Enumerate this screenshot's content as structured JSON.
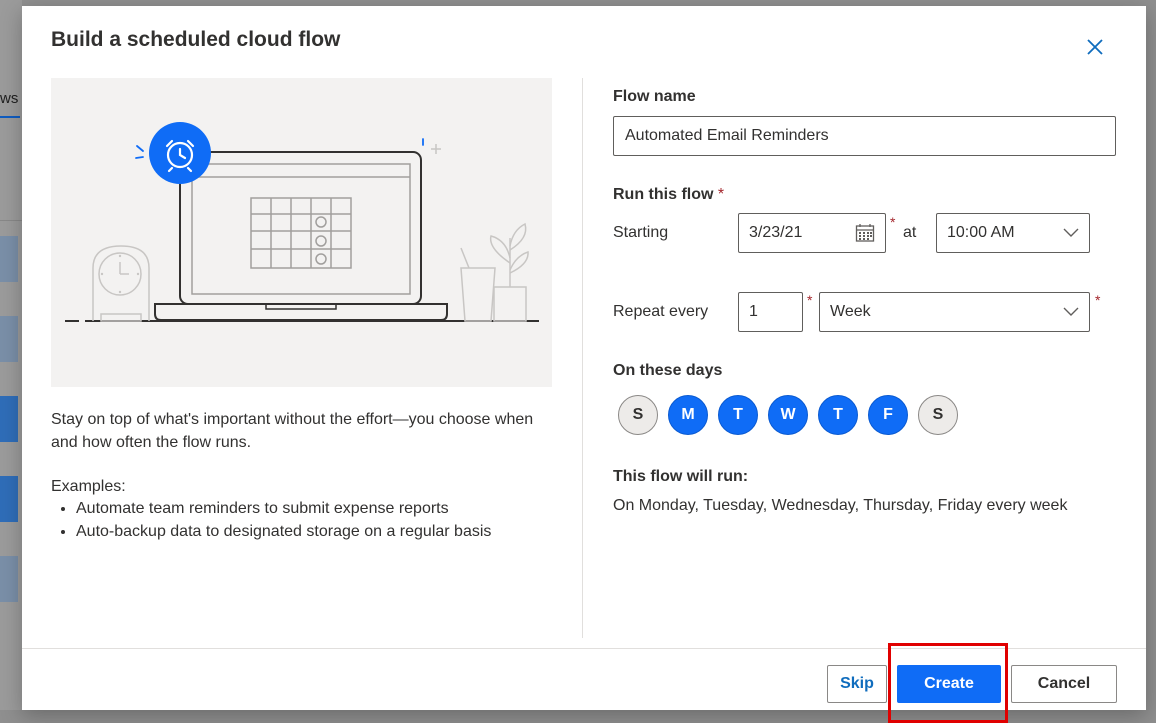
{
  "background": {
    "tab_fragment": "ws"
  },
  "dialog": {
    "title": "Build a scheduled cloud flow",
    "description": "Stay on top of what's important without the effort—you choose when and how often the flow runs.",
    "examples_label": "Examples:",
    "examples": [
      "Automate team reminders to submit expense reports",
      "Auto-backup data to designated storage on a regular basis"
    ]
  },
  "form": {
    "flow_name_label": "Flow name",
    "flow_name_value": "Automated Email Reminders",
    "run_label": "Run this flow",
    "required_mark": "*",
    "starting_label": "Starting",
    "start_date": "3/23/21",
    "at_label": "at",
    "start_time": "10:00 AM",
    "repeat_label": "Repeat every",
    "repeat_interval": "1",
    "repeat_unit": "Week",
    "days_label": "On these days",
    "days": [
      {
        "letter": "S",
        "selected": false
      },
      {
        "letter": "M",
        "selected": true
      },
      {
        "letter": "T",
        "selected": true
      },
      {
        "letter": "W",
        "selected": true
      },
      {
        "letter": "T",
        "selected": true
      },
      {
        "letter": "F",
        "selected": true
      },
      {
        "letter": "S",
        "selected": false
      }
    ],
    "summary_label": "This flow will run:",
    "summary_text": "On Monday, Tuesday, Wednesday, Thursday, Friday every week"
  },
  "buttons": {
    "skip": "Skip",
    "create": "Create",
    "cancel": "Cancel"
  },
  "colors": {
    "accent": "#0f6cf6",
    "required": "#a4262c",
    "highlight": "#e00000"
  },
  "icons": {
    "close": "close-icon",
    "calendar": "calendar-icon",
    "chevron": "chevron-down-icon",
    "alarm": "alarm-clock-icon"
  }
}
